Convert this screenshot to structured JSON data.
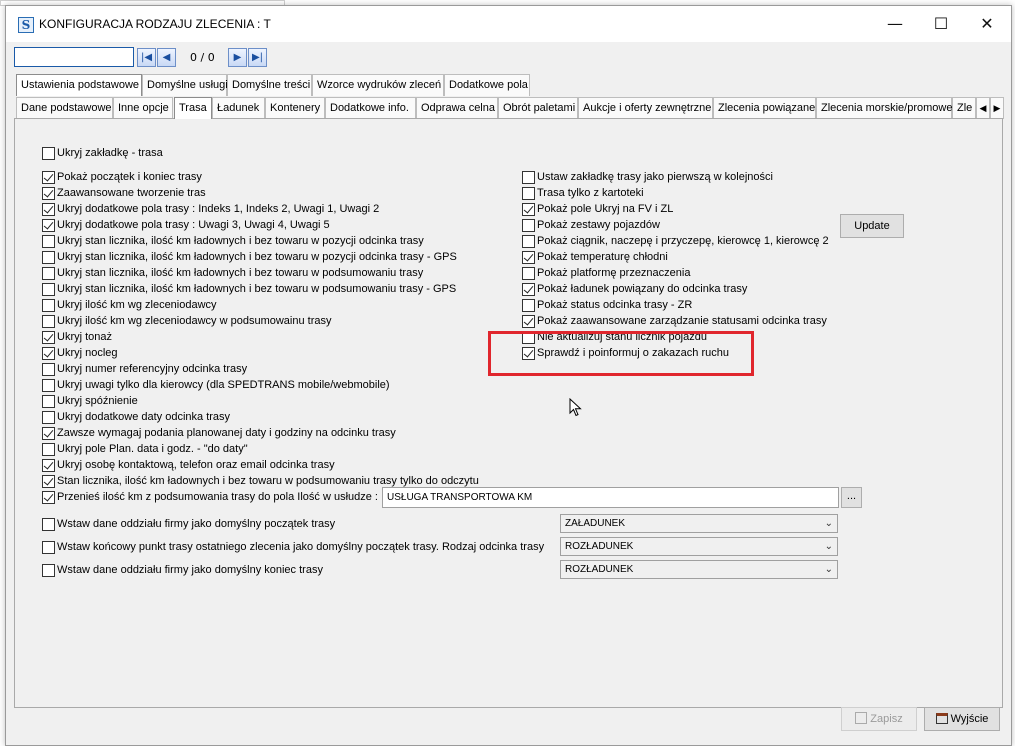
{
  "window": {
    "title": "KONFIGURACJA RODZAJU ZLECENIA : T",
    "icon_letter": "S",
    "minimize": "—",
    "maximize": "☐",
    "close": "✕"
  },
  "nav": {
    "input_value": "",
    "counter": "0 / 0"
  },
  "top_tabs": [
    "Ustawienia podstawowe",
    "Domyślne usługi",
    "Domyślne treści",
    "Wzorce wydruków zleceń",
    "Dodatkowe pola"
  ],
  "sub_tabs": [
    "Dane podstawowe",
    "Inne opcje",
    "Trasa",
    "Ładunek",
    "Kontenery",
    "Dodatkowe info.",
    "Odprawa celna",
    "Obrót paletami",
    "Aukcje i oferty zewnętrzne",
    "Zlecenia powiązane",
    "Zlecenia morskie/promowe",
    "Zle"
  ],
  "left_checks": [
    {
      "label": "Ukryj zakładkę - trasa",
      "checked": false
    },
    {
      "label": "Pokaż początek i koniec trasy",
      "checked": true
    },
    {
      "label": "Zaawansowane tworzenie tras",
      "checked": true
    },
    {
      "label": "Ukryj dodatkowe pola trasy : Indeks 1, Indeks 2, Uwagi 1, Uwagi 2",
      "checked": true
    },
    {
      "label": "Ukryj dodatkowe pola trasy : Uwagi 3, Uwagi 4, Uwagi 5",
      "checked": true
    },
    {
      "label": "Ukryj stan licznika, ilość km ładownych i bez towaru w pozycji odcinka trasy",
      "checked": false
    },
    {
      "label": "Ukryj stan licznika, ilość km ładownych i bez towaru w pozycji odcinka trasy - GPS",
      "checked": false
    },
    {
      "label": "Ukryj stan licznika, ilość km ładownych i bez towaru w podsumowaniu trasy",
      "checked": false
    },
    {
      "label": "Ukryj stan licznika, ilość km ładownych i bez towaru w podsumowaniu trasy - GPS",
      "checked": false
    },
    {
      "label": "Ukryj ilość km wg zleceniodawcy",
      "checked": false
    },
    {
      "label": "Ukryj ilość km wg zleceniodawcy w podsumowainu trasy",
      "checked": false
    },
    {
      "label": "Ukryj tonaż",
      "checked": true
    },
    {
      "label": "Ukryj nocleg",
      "checked": true
    },
    {
      "label": "Ukryj numer referencyjny odcinka trasy",
      "checked": false
    },
    {
      "label": "Ukryj uwagi tylko dla kierowcy (dla SPEDTRANS mobile/webmobile)",
      "checked": false
    },
    {
      "label": "Ukryj spóźnienie",
      "checked": false
    },
    {
      "label": "Ukryj dodatkowe daty odcinka trasy",
      "checked": false
    },
    {
      "label": "Zawsze wymagaj podania planowanej daty i godziny na odcinku trasy",
      "checked": true
    },
    {
      "label": "Ukryj pole Plan. data i godz. - \"do daty\"",
      "checked": false
    },
    {
      "label": "Ukryj osobę kontaktową, telefon oraz email odcinka trasy",
      "checked": true
    },
    {
      "label": "Stan licznika, ilość km ładownych i bez towaru w podsumowaniu trasy tylko do odczytu",
      "checked": true
    },
    {
      "label": "Przenieś ilość km z podsumowania trasy do pola Ilość w usłudze :",
      "checked": true
    }
  ],
  "right_checks": [
    {
      "label": "Ustaw zakładkę trasy jako pierwszą w kolejności",
      "checked": false
    },
    {
      "label": "Trasa tylko z kartoteki",
      "checked": false
    },
    {
      "label": "Pokaż pole Ukryj na FV i ZL",
      "checked": true
    },
    {
      "label": "Pokaż zestawy pojazdów",
      "checked": false
    },
    {
      "label": "Pokaż ciągnik, naczepę i przyczepę, kierowcę 1, kierowcę 2",
      "checked": false
    },
    {
      "label": "Pokaż temperaturę chłodni",
      "checked": true
    },
    {
      "label": "Pokaż platformę przeznaczenia",
      "checked": false
    },
    {
      "label": "Pokaż ładunek powiązany do odcinka trasy",
      "checked": true
    },
    {
      "label": "Pokaż status odcinka trasy - ZR",
      "checked": false
    },
    {
      "label": "Pokaż zaawansowane zarządzanie statusami odcinka trasy",
      "checked": true
    },
    {
      "label": "Nie aktualizuj stanu licznik pojazdu",
      "checked": false
    },
    {
      "label": "Sprawdź i poinformuj o zakazach ruchu",
      "checked": true
    }
  ],
  "update_button": "Update",
  "service_field": {
    "value": "USŁUGA TRANSPORTOWA KM",
    "browse": "..."
  },
  "bottom_options": [
    {
      "label": "Wstaw dane oddziału firmy jako domyślny początek trasy",
      "checked": false,
      "select": "ZAŁADUNEK"
    },
    {
      "label": "Wstaw końcowy punkt trasy ostatniego zlecenia jako domyślny początek trasy. Rodzaj odcinka trasy",
      "checked": false,
      "select": "ROZŁADUNEK"
    },
    {
      "label": "Wstaw dane oddziału firmy jako domyślny koniec trasy",
      "checked": false,
      "select": "ROZŁADUNEK"
    }
  ],
  "footer": {
    "save": "Zapisz",
    "exit": "Wyjście"
  }
}
